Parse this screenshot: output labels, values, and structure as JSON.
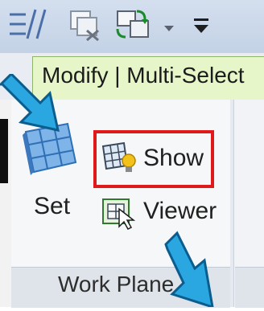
{
  "ribbon": {
    "tab_label": "Modify | Multi-Select",
    "work_plane_panel": {
      "footer_label": "Work Plane",
      "set_label": "Set",
      "show_label": "Show",
      "viewer_label": "Viewer"
    }
  },
  "quick_access_toolbar": {
    "icons": [
      "grid-lines-icon",
      "close-hidden-windows-icon",
      "switch-windows-icon",
      "chevron-down-icon",
      "customize-toolbar-icon"
    ]
  },
  "annotations": {
    "arrow_color": "#2aa7e0",
    "highlight_color": "#e01a1a"
  }
}
